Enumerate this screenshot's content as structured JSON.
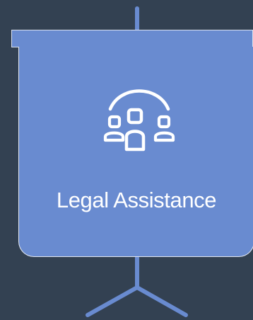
{
  "panel": {
    "title": "Legal Assistance",
    "icon": "team-group-icon"
  },
  "colors": {
    "background": "#334152",
    "panel": "#698BD0",
    "outline": "#E3E8F2",
    "stand": "#698BD0",
    "text": "#FFFFFF"
  }
}
